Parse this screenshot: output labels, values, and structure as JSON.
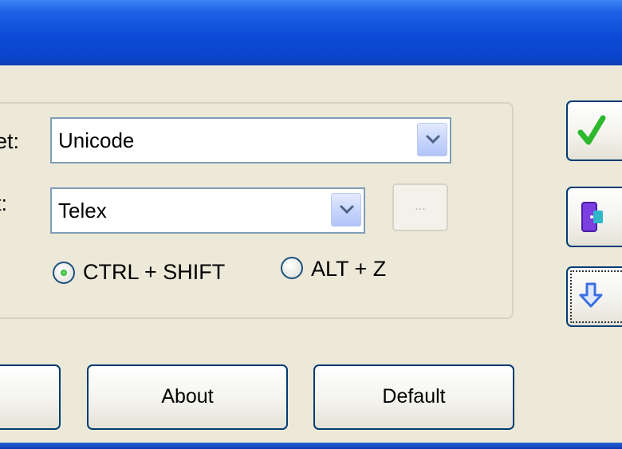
{
  "window": {
    "title": ""
  },
  "settings": {
    "charset_label_partial": "et:",
    "charset_value": "Unicode",
    "input_label_partial": "t:",
    "input_method_value": "Telex",
    "ellipsis_label": "...",
    "hotkey_options": [
      {
        "label": "CTRL + SHIFT",
        "selected": true
      },
      {
        "label": "ALT + Z",
        "selected": false
      }
    ]
  },
  "buttons": {
    "about_label": "About",
    "default_label": "Default"
  },
  "side_buttons": [
    {
      "icon": "checkmark-icon",
      "color": "#2db82d"
    },
    {
      "icon": "exit-door-icon",
      "color": "#6a2fd1"
    },
    {
      "icon": "down-arrow-icon",
      "color": "#3b6fe0"
    }
  ]
}
